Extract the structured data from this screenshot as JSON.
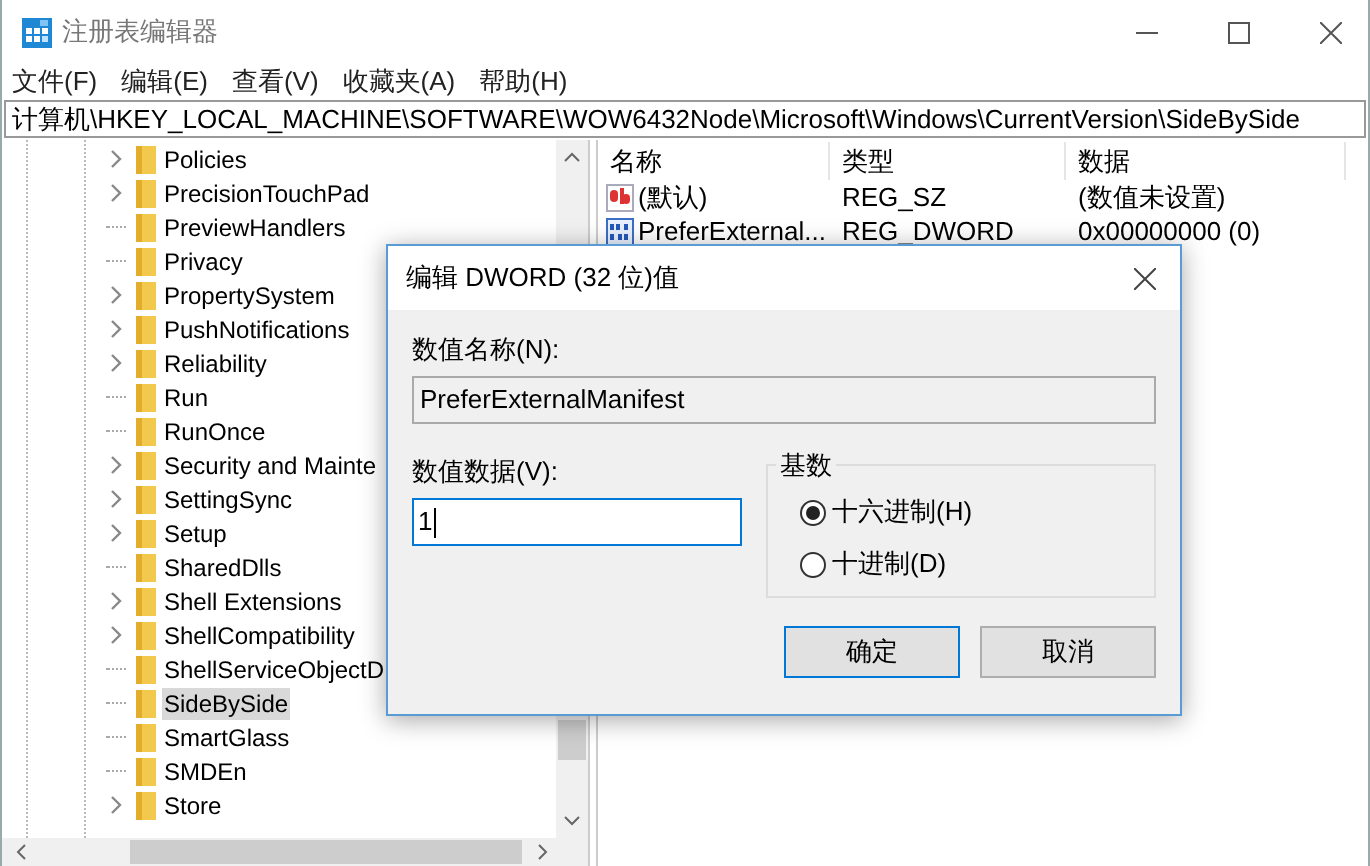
{
  "window": {
    "title": "注册表编辑器"
  },
  "menu": [
    "文件(F)",
    "编辑(E)",
    "查看(V)",
    "收藏夹(A)",
    "帮助(H)"
  ],
  "address": "计算机\\HKEY_LOCAL_MACHINE\\SOFTWARE\\WOW6432Node\\Microsoft\\Windows\\CurrentVersion\\SideBySide",
  "tree": {
    "items": [
      {
        "label": "Policies",
        "expandable": true,
        "selected": false
      },
      {
        "label": "PrecisionTouchPad",
        "expandable": true,
        "selected": false
      },
      {
        "label": "PreviewHandlers",
        "expandable": false,
        "selected": false
      },
      {
        "label": "Privacy",
        "expandable": false,
        "selected": false
      },
      {
        "label": "PropertySystem",
        "expandable": true,
        "selected": false
      },
      {
        "label": "PushNotifications",
        "expandable": true,
        "selected": false
      },
      {
        "label": "Reliability",
        "expandable": true,
        "selected": false
      },
      {
        "label": "Run",
        "expandable": false,
        "selected": false
      },
      {
        "label": "RunOnce",
        "expandable": false,
        "selected": false
      },
      {
        "label": "Security and Mainte",
        "expandable": true,
        "selected": false
      },
      {
        "label": "SettingSync",
        "expandable": true,
        "selected": false
      },
      {
        "label": "Setup",
        "expandable": true,
        "selected": false
      },
      {
        "label": "SharedDlls",
        "expandable": false,
        "selected": false
      },
      {
        "label": "Shell Extensions",
        "expandable": true,
        "selected": false
      },
      {
        "label": "ShellCompatibility",
        "expandable": true,
        "selected": false
      },
      {
        "label": "ShellServiceObjectD",
        "expandable": false,
        "selected": false
      },
      {
        "label": "SideBySide",
        "expandable": false,
        "selected": true
      },
      {
        "label": "SmartGlass",
        "expandable": false,
        "selected": false
      },
      {
        "label": "SMDEn",
        "expandable": false,
        "selected": false
      },
      {
        "label": "Store",
        "expandable": true,
        "selected": false
      }
    ]
  },
  "values": {
    "columns": [
      "名称",
      "类型",
      "数据"
    ],
    "rows": [
      {
        "kind": "string",
        "name": "(默认)",
        "type": "REG_SZ",
        "data": "(数值未设置)"
      },
      {
        "kind": "binary",
        "name": "PreferExternal...",
        "type": "REG_DWORD",
        "data": "0x00000000 (0)"
      }
    ]
  },
  "dialog": {
    "title": "编辑 DWORD (32 位)值",
    "name_label": "数值名称(N):",
    "name_value": "PreferExternalManifest",
    "data_label": "数值数据(V):",
    "data_value": "1",
    "base_label": "基数",
    "bases": [
      {
        "label": "十六进制(H)",
        "selected": true
      },
      {
        "label": "十进制(D)",
        "selected": false
      }
    ],
    "buttons": [
      {
        "label": "确定",
        "default": true
      },
      {
        "label": "取消",
        "default": false
      }
    ]
  }
}
